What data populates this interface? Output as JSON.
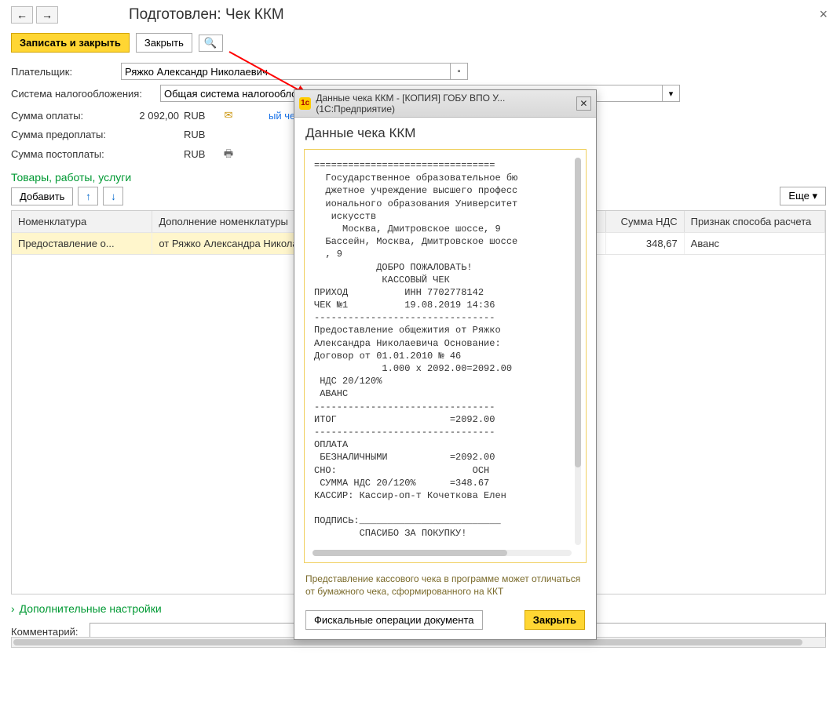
{
  "header": {
    "title": "Подготовлен: Чек ККМ"
  },
  "toolbar": {
    "save_close": "Записать и закрыть",
    "close": "Закрыть",
    "preview_icon": "🔍"
  },
  "form": {
    "payer_label": "Плательщик:",
    "payer_value": "Ряжко Александр Николаевич",
    "tax_label": "Система налогообложения:",
    "tax_value": "Общая система налогооблож"
  },
  "amounts": {
    "pay_label": "Сумма оплаты:",
    "pay_value": "2 092,00",
    "currency": "RUB",
    "prepay_label": "Сумма предоплаты:",
    "postpay_label": "Сумма постоплаты:",
    "link_new": "ый чек"
  },
  "section": {
    "title": "Товары, работы, услуги",
    "add": "Добавить",
    "more": "Еще"
  },
  "table": {
    "cols": [
      "Номенклатура",
      "Дополнение номенклатуры",
      "",
      "Сумма НДС",
      "Признак способа расчета"
    ],
    "row": {
      "col1": "Предоставление о...",
      "col2": "от Ряжко Александра Никола",
      "col4": "348,67",
      "col5": "Аванс"
    }
  },
  "collapsible": "Дополнительные настройки",
  "comment_label": "Комментарий:",
  "dialog": {
    "titlebar": "Данные чека ККМ - [КОПИЯ] ГОБУ ВПО У...  (1С:Предприятие)",
    "heading": "Данные чека ККМ",
    "receipt": "================================\n  Государственное образовательное бю\n  джетное учреждение высшего професс\n  ионального образования Университет\n   искусств\n     Москва, Дмитровское шоссе, 9\n  Бассейн, Москва, Дмитровское шоссе\n  , 9\n           ДОБРО ПОЖАЛОВАТЬ!\n            КАССОВЫЙ ЧЕК\nПРИХОД          ИНН 7702778142\nЧЕК №1          19.08.2019 14:36\n--------------------------------\nПредоставление общежития от Ряжко\nАлександра Николаевича Основание:\nДоговор от 01.01.2010 № 46\n            1.000 x 2092.00=2092.00\n НДС 20/120%\n АВАНС\n--------------------------------\nИТОГ                    =2092.00\n--------------------------------\nОПЛАТА\n БЕЗНАЛИЧНЫМИ           =2092.00\nСНО:                        ОСН\n СУММА НДС 20/120%      =348.67\nКАССИР: Кассир-оп-т Кочеткова Елен\n\nПОДПИСЬ:_________________________\n        СПАСИБО ЗА ПОКУПКУ!",
    "note": "Представление кассового чека в программе может отличаться от бумажного чека, сформированного на ККТ",
    "fiscal_btn": "Фискальные операции документа",
    "close_btn": "Закрыть"
  }
}
